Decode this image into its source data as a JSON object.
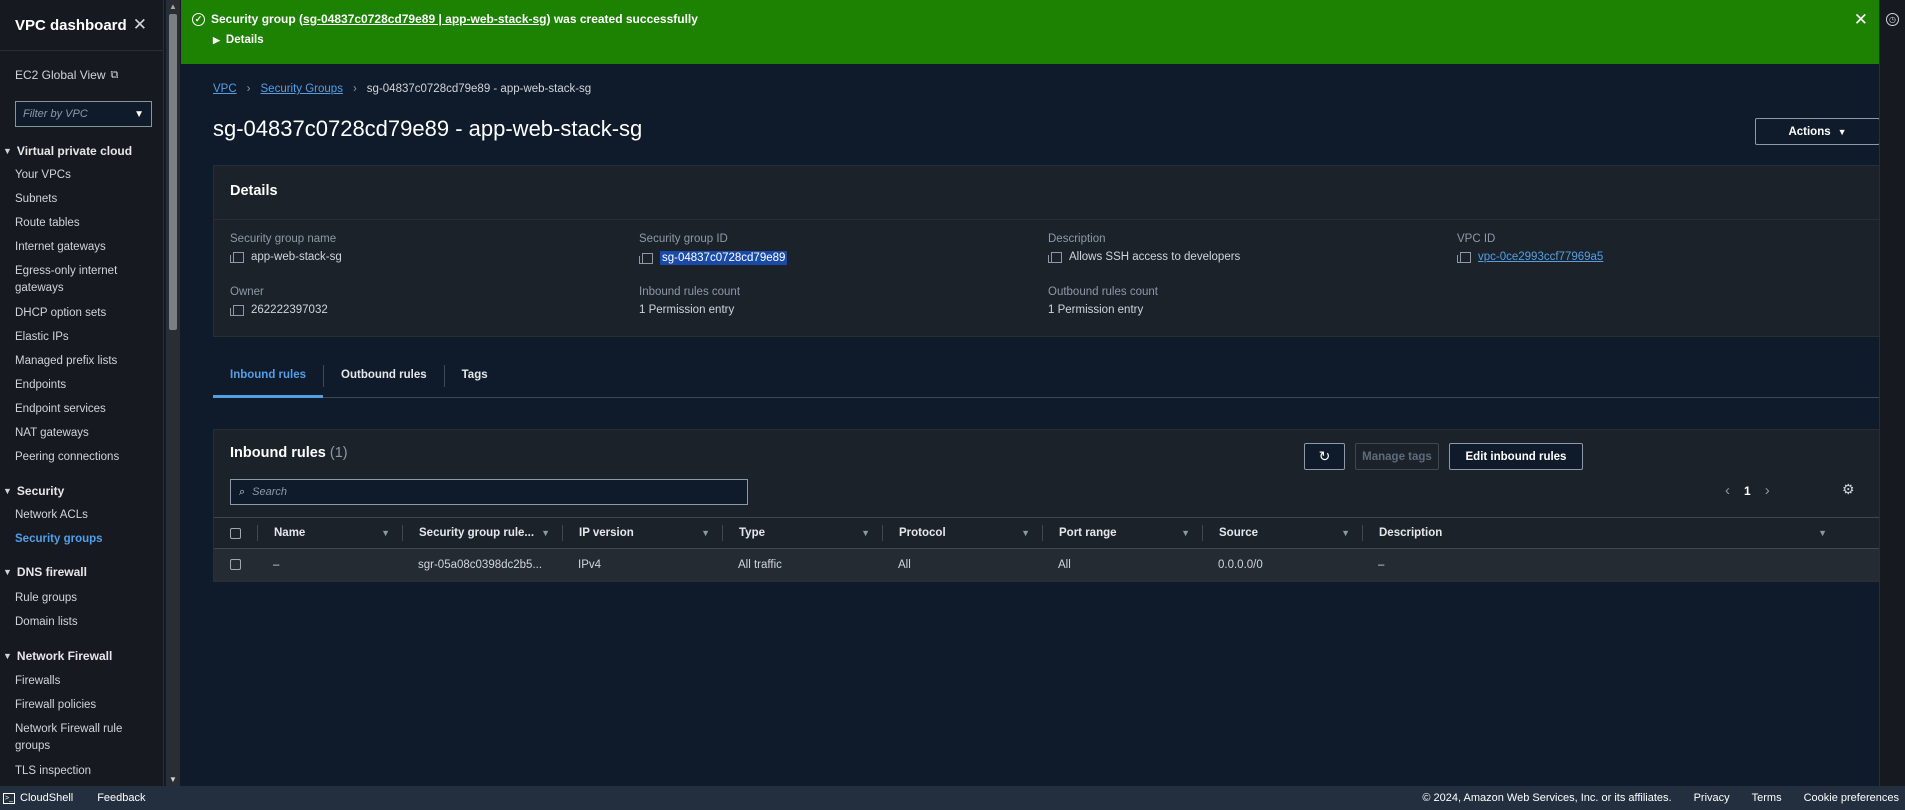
{
  "sidebar": {
    "title": "VPC dashboard",
    "ec2_global_view": "EC2 Global View",
    "filter_placeholder": "Filter by VPC",
    "sections": [
      {
        "label": "Virtual private cloud",
        "items": [
          "Your VPCs",
          "Subnets",
          "Route tables",
          "Internet gateways",
          "Egress-only internet gateways",
          "DHCP option sets",
          "Elastic IPs",
          "Managed prefix lists",
          "Endpoints",
          "Endpoint services",
          "NAT gateways",
          "Peering connections"
        ]
      },
      {
        "label": "Security",
        "items": [
          "Network ACLs",
          "Security groups"
        ]
      },
      {
        "label": "DNS firewall",
        "items": [
          "Rule groups",
          "Domain lists"
        ]
      },
      {
        "label": "Network Firewall",
        "items": [
          "Firewalls",
          "Firewall policies",
          "Network Firewall rule groups",
          "TLS inspection"
        ]
      }
    ],
    "active_item": "Security groups"
  },
  "flash": {
    "prefix": "Security group (",
    "link_text": "sg-04837c0728cd79e89 | app-web-stack-sg",
    "suffix": ") was created successfully",
    "details_label": "Details"
  },
  "breadcrumb": {
    "vpc": "VPC",
    "security_groups": "Security Groups",
    "current": "sg-04837c0728cd79e89 - app-web-stack-sg"
  },
  "page_title": "sg-04837c0728cd79e89 - app-web-stack-sg",
  "actions_label": "Actions",
  "details": {
    "header": "Details",
    "sg_name_label": "Security group name",
    "sg_name": "app-web-stack-sg",
    "sg_id_label": "Security group ID",
    "sg_id": "sg-04837c0728cd79e89",
    "description_label": "Description",
    "description": "Allows SSH access to developers",
    "vpc_id_label": "VPC ID",
    "vpc_id": "vpc-0ce2993ccf77969a5",
    "owner_label": "Owner",
    "owner": "262222397032",
    "inbound_count_label": "Inbound rules count",
    "inbound_count": "1 Permission entry",
    "outbound_count_label": "Outbound rules count",
    "outbound_count": "1 Permission entry"
  },
  "tabs": [
    "Inbound rules",
    "Outbound rules",
    "Tags"
  ],
  "rules": {
    "title": "Inbound rules",
    "count": "(1)",
    "manage_tags": "Manage tags",
    "edit_inbound": "Edit inbound rules",
    "search_placeholder": "Search",
    "page": "1",
    "columns": [
      "Name",
      "Security group rule...",
      "IP version",
      "Type",
      "Protocol",
      "Port range",
      "Source",
      "Description"
    ],
    "rows": [
      [
        "–",
        "sgr-05a08c0398dc2b5...",
        "IPv4",
        "All traffic",
        "All",
        "All",
        "0.0.0.0/0",
        "–"
      ]
    ]
  },
  "footer": {
    "cloudshell": "CloudShell",
    "feedback": "Feedback",
    "copyright": "© 2024, Amazon Web Services, Inc. or its affiliates.",
    "privacy": "Privacy",
    "terms": "Terms",
    "cookie": "Cookie preferences"
  },
  "colors": {
    "flash_bg": "#1d8102",
    "link": "#539fe5",
    "bg": "#0f1b2a"
  }
}
